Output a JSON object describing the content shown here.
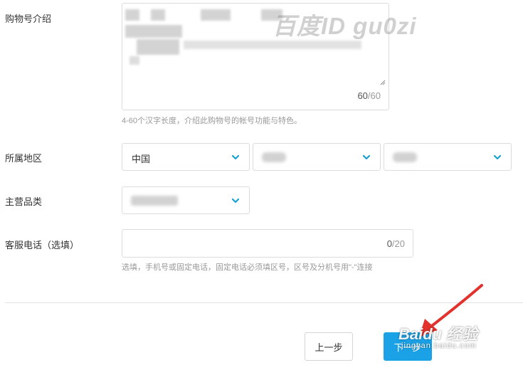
{
  "form": {
    "intro": {
      "label": "购物号介绍",
      "counter_current": "60",
      "counter_max": "/60",
      "hint": "4-60个汉字长度，介绍此购物号的帐号功能与特色。"
    },
    "region": {
      "label": "所属地区",
      "country_value": "中国",
      "province_value": "",
      "city_value": ""
    },
    "category": {
      "label": "主营品类",
      "value": ""
    },
    "phone": {
      "label": "客服电话（选填）",
      "counter_current": "0",
      "counter_max": "/20",
      "hint": "选填，手机号或固定电话，固定电话必须填区号，区号及分机号用\"-\"连接"
    }
  },
  "buttons": {
    "prev_label": "上一步",
    "next_label": "下一步"
  },
  "overlays": {
    "watermark": "百度ID gu0zi",
    "jingyan_main": "Baidu 经验",
    "jingyan_sub": "jingyan.baidu.com"
  },
  "colors": {
    "primary": "#1aa1e6",
    "chevron": "#1a9fd4",
    "arrow": "#e2322d"
  },
  "icons": {
    "select_chevron": "chevron-down-icon",
    "resize": "resize-handle-icon",
    "pointer_arrow": "red-arrow"
  }
}
